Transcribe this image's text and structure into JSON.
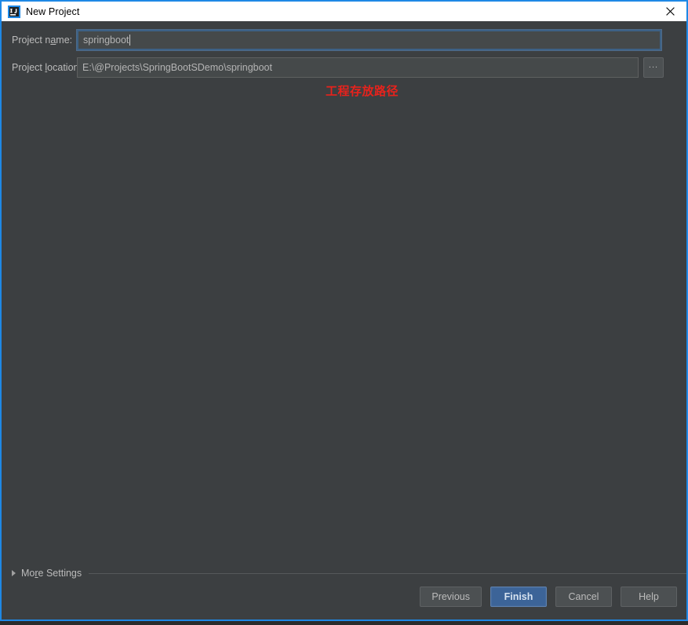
{
  "window": {
    "title": "New Project",
    "app_icon": "intellij-idea-icon",
    "close_icon": "close-icon",
    "accent_color": "#1e88e5",
    "background_color": "#3c3f41"
  },
  "form": {
    "project_name": {
      "label_prefix": "Project n",
      "label_mnemonic": "a",
      "label_suffix": "me:",
      "value": "springboot",
      "focused": true
    },
    "project_location": {
      "label_prefix": "Project ",
      "label_mnemonic": "l",
      "label_suffix": "ocation:",
      "value": "E:\\@Projects\\SpringBootSDemo\\springboot",
      "focused": false
    },
    "browse_button_label": "...",
    "annotation": {
      "text": "工程存放路径",
      "color": "#e8221c"
    }
  },
  "more_settings": {
    "label_prefix": "Mo",
    "label_mnemonic": "r",
    "label_suffix": "e Settings",
    "expanded": false,
    "chevron_icon": "chevron-right-icon"
  },
  "buttons": {
    "previous": "Previous",
    "finish": "Finish",
    "cancel": "Cancel",
    "help": "Help",
    "default_button": "Finish",
    "default_color": "#3c6498"
  }
}
